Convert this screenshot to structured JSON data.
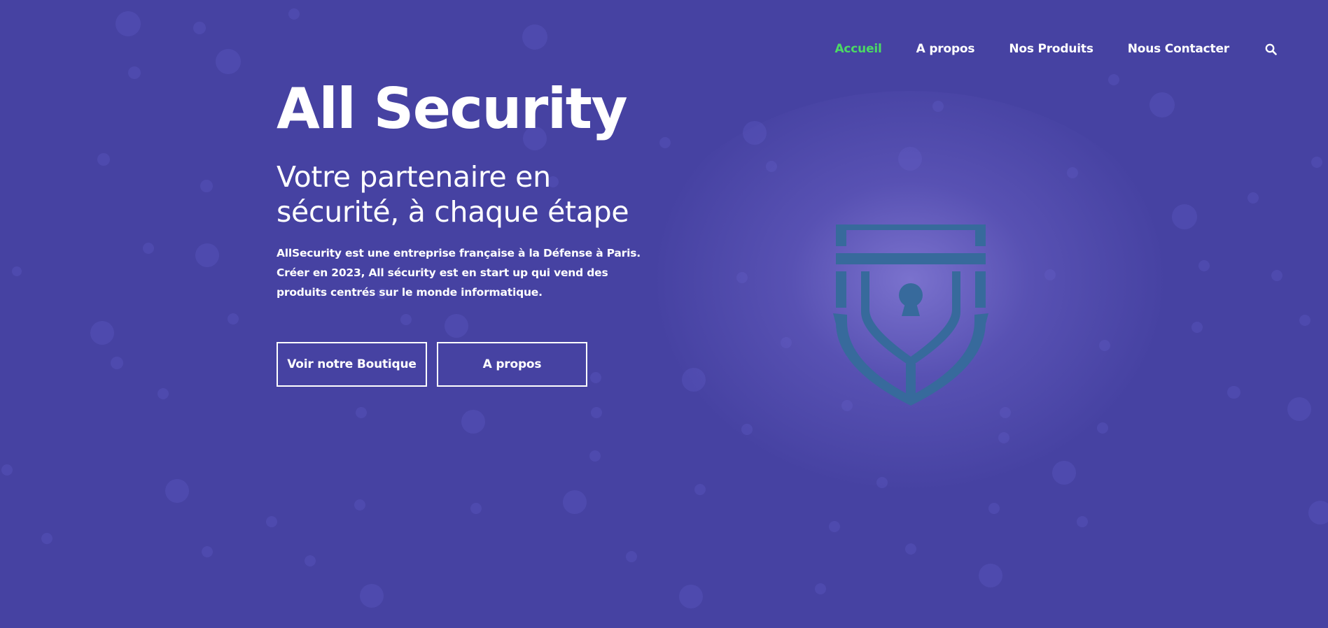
{
  "nav": {
    "items": [
      {
        "label": "Accueil",
        "active": true
      },
      {
        "label": "A propos",
        "active": false
      },
      {
        "label": "Nos Produits",
        "active": false
      },
      {
        "label": "Nous Contacter",
        "active": false
      }
    ],
    "search_icon": "search-icon"
  },
  "hero": {
    "title": "All Security",
    "subtitle": "Votre partenaire en sécurité, à chaque étape",
    "description": "AllSecurity est une entreprise française à la Défense à Paris. Créer en 2023, All sécurity est en start up qui vend des produits centrés sur le monde informatique.",
    "buttons": {
      "shop_label": "Voir notre Boutique",
      "about_label": "A propos"
    },
    "illustration_icon": "shield-lock-icon"
  },
  "colors": {
    "background": "#4642a2",
    "accent_active": "#4cd964",
    "shield": "#376a9c",
    "text": "#ffffff"
  }
}
